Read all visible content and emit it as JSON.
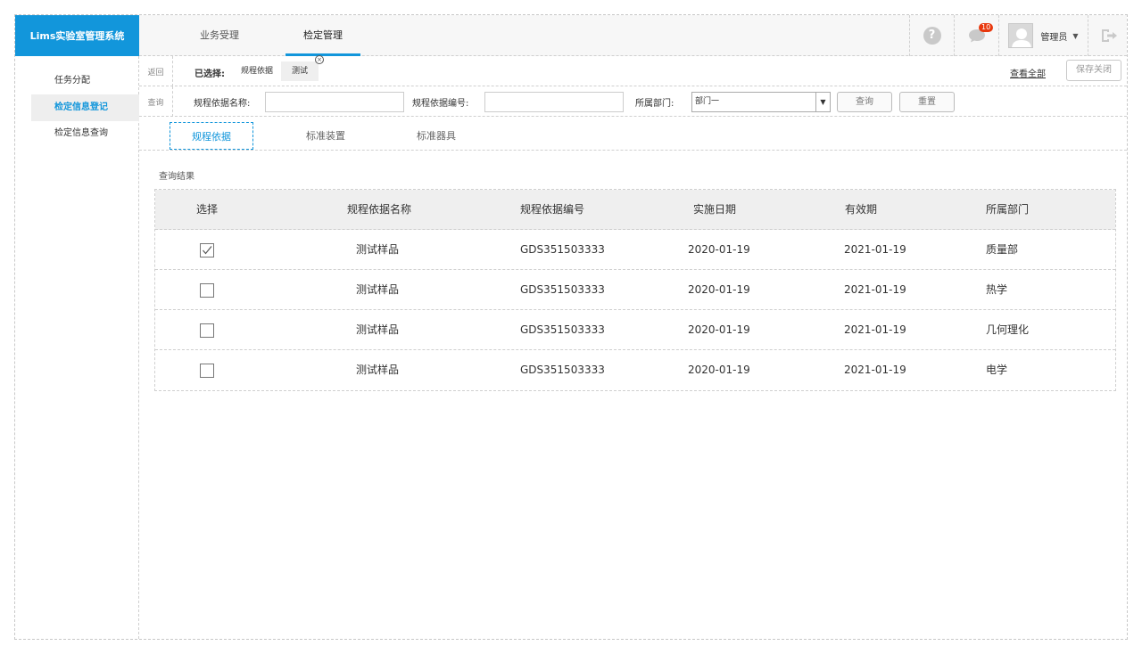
{
  "app": {
    "title": "Lims实验室管理系统"
  },
  "top_nav": {
    "tabs": [
      {
        "label": "业务受理"
      },
      {
        "label": "检定管理"
      }
    ]
  },
  "header": {
    "notification_count": "10",
    "user_name": "管理员"
  },
  "sidebar": {
    "items": [
      {
        "label": "任务分配"
      },
      {
        "label": "检定信息登记"
      },
      {
        "label": "检定信息查询"
      }
    ]
  },
  "selection": {
    "back_label": "返回",
    "selected_title": "已选择:",
    "chips": [
      {
        "label": "规程依据"
      },
      {
        "label": "测试"
      }
    ],
    "view_all": "查看全部",
    "save_close": "保存关闭"
  },
  "query": {
    "row_label": "查询",
    "name_label": "规程依据名称:",
    "name_value": "",
    "code_label": "规程依据编号:",
    "code_value": "",
    "dept_label": "所属部门:",
    "dept_value": "部门一",
    "query_button": "查询",
    "reset_button": "重置"
  },
  "subtabs": [
    {
      "label": "规程依据"
    },
    {
      "label": "标准装置"
    },
    {
      "label": "标准器具"
    }
  ],
  "results": {
    "title": "查询结果",
    "columns": [
      "选择",
      "规程依据名称",
      "规程依据编号",
      "实施日期",
      "有效期",
      "所属部门"
    ],
    "rows": [
      {
        "checked": true,
        "name": "测试样品",
        "code": "GDS351503333",
        "start": "2020-01-19",
        "valid": "2021-01-19",
        "dept": "质量部"
      },
      {
        "checked": false,
        "name": "测试样品",
        "code": "GDS351503333",
        "start": "2020-01-19",
        "valid": "2021-01-19",
        "dept": "热学"
      },
      {
        "checked": false,
        "name": "测试样品",
        "code": "GDS351503333",
        "start": "2020-01-19",
        "valid": "2021-01-19",
        "dept": "几何理化"
      },
      {
        "checked": false,
        "name": "测试样品",
        "code": "GDS351503333",
        "start": "2020-01-19",
        "valid": "2021-01-19",
        "dept": "电学"
      }
    ]
  }
}
